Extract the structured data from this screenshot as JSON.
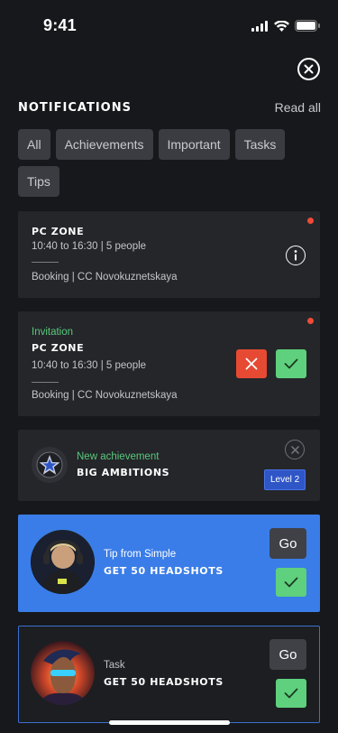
{
  "status": {
    "time": "9:41"
  },
  "header": {
    "title": "NOTIFICATIONS",
    "read_all": "Read all"
  },
  "filters": [
    "All",
    "Achievements",
    "Important",
    "Tasks",
    "Tips"
  ],
  "cards": {
    "booking": {
      "title": "PC ZONE",
      "time": "10:40 to 16:30 | 5 people",
      "place": "Booking | CC Novokuznetskaya"
    },
    "invitation": {
      "label": "Invitation",
      "title": "PC ZONE",
      "time": "10:40 to 16:30 | 5 people",
      "place": "Booking | CC Novokuznetskaya"
    },
    "achievement": {
      "label": "New achievement",
      "title": "BIG AMBITIONS",
      "level": "Level 2"
    },
    "tip": {
      "label": "Tip from Simple",
      "title": "GET 50 HEADSHOTS",
      "go": "Go"
    },
    "task": {
      "label": "Task",
      "title": "GET 50 HEADSHOTS",
      "go": "Go"
    }
  },
  "colors": {
    "background": "#17181b",
    "card": "#24262a",
    "accent_blue": "#3a7de8",
    "green": "#5fd07d",
    "red": "#e64a33",
    "unread_dot": "#ef4b37"
  }
}
